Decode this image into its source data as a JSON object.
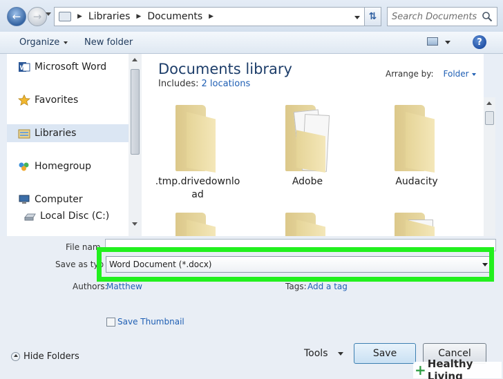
{
  "address": {
    "crumbs": [
      "Libraries",
      "Documents"
    ],
    "search_placeholder": "Search Documents"
  },
  "toolbar": {
    "organize_label": "Organize",
    "new_folder_label": "New folder",
    "help_label": "?"
  },
  "nav": {
    "items": [
      {
        "label": "Microsoft Word",
        "icon": "word-icon"
      },
      {
        "label": "Favorites",
        "icon": "star-icon"
      },
      {
        "label": "Libraries",
        "icon": "libraries-icon"
      },
      {
        "label": "Homegroup",
        "icon": "homegroup-icon"
      },
      {
        "label": "Computer",
        "icon": "computer-icon"
      },
      {
        "label": "Local Disc (C:)",
        "icon": "drive-icon"
      }
    ]
  },
  "content": {
    "title": "Documents library",
    "includes_label": "Includes:",
    "includes_link": "2 locations",
    "arrange_label": "Arrange by:",
    "arrange_value": "Folder",
    "folders": [
      {
        "name": ".tmp.drivedownlo",
        "name2": "ad"
      },
      {
        "name": "Adobe"
      },
      {
        "name": "Audacity"
      }
    ]
  },
  "form": {
    "filename_label": "File nam",
    "savetype_label": "Save as typ",
    "savetype_value": "Word Document (*.docx)",
    "authors_label": "Authors:",
    "authors_value": "Matthew",
    "tags_label": "Tags:",
    "tags_value": "Add a tag",
    "thumbnail_label": "Save Thumbnail"
  },
  "footer": {
    "hide_folders_label": "Hide Folders",
    "tools_label": "Tools",
    "save_label": "Save",
    "cancel_label": "Cancel"
  },
  "watermark": {
    "plus": "+",
    "text": "Healthy Living"
  },
  "colors": {
    "highlight": "#22f01e",
    "link": "#1f5fb4"
  }
}
